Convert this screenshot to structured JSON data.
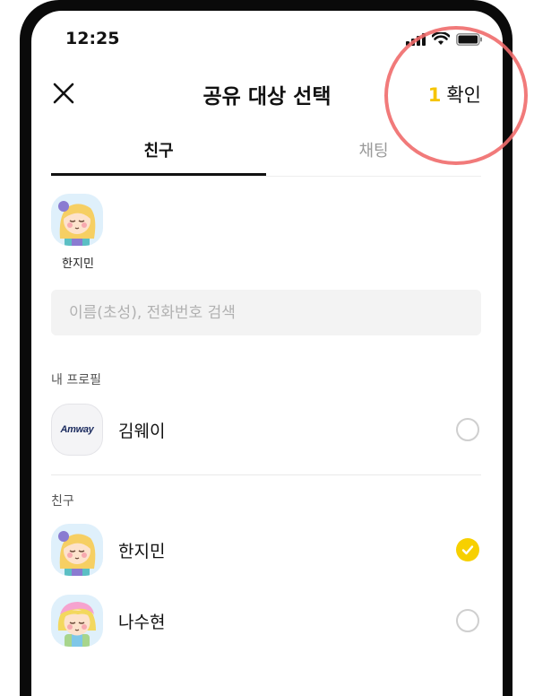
{
  "status_bar": {
    "time": "12:25"
  },
  "header": {
    "title": "공유 대상 선택",
    "confirm_count": "1",
    "confirm_label": "확인",
    "close_icon": "close-icon"
  },
  "tabs": [
    {
      "label": "친구",
      "active": true
    },
    {
      "label": "채팅",
      "active": false
    }
  ],
  "selected": [
    {
      "name": "한지민"
    }
  ],
  "search": {
    "placeholder": "이름(초성), 전화번호 검색",
    "value": ""
  },
  "my_profile": {
    "section_label": "내 프로필",
    "name": "김웨이",
    "logo_text": "Amway",
    "checked": false
  },
  "friends": {
    "section_label": "친구",
    "items": [
      {
        "name": "한지민",
        "checked": true
      },
      {
        "name": "나수현",
        "checked": false
      }
    ]
  },
  "colors": {
    "accent": "#F7D000",
    "highlight": "#F06B6B"
  }
}
